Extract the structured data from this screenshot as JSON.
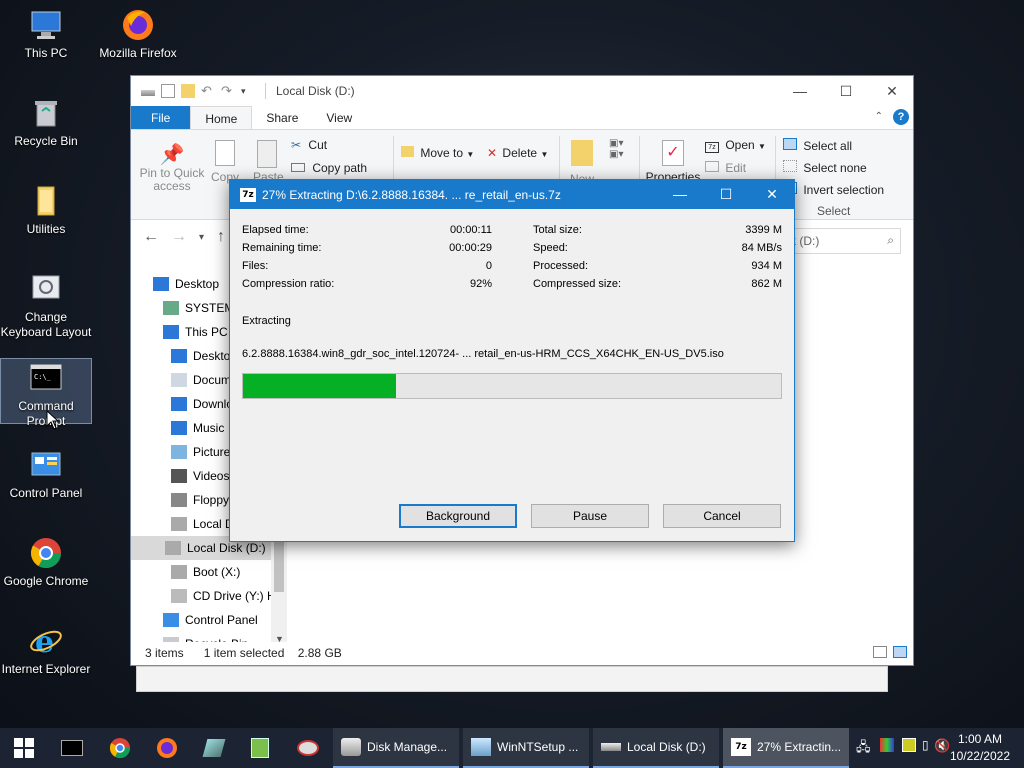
{
  "desktop": {
    "icons": [
      {
        "label": "This PC",
        "icon": "pc-icon"
      },
      {
        "label": "Mozilla Firefox",
        "icon": "firefox-icon"
      },
      {
        "label": "Recycle Bin",
        "icon": "recycle-bin-icon"
      },
      {
        "label": "Utilities",
        "icon": "folder-icon"
      },
      {
        "label": "Change Keyboard Layout",
        "icon": "keyboard-layout-icon"
      },
      {
        "label": "Command Prompt",
        "icon": "cmd-icon"
      },
      {
        "label": "Control Panel",
        "icon": "control-panel-icon"
      },
      {
        "label": "Google Chrome",
        "icon": "chrome-icon"
      },
      {
        "label": "Internet Explorer",
        "icon": "ie-icon"
      }
    ]
  },
  "explorer": {
    "title": "Local Disk (D:)",
    "tabs": {
      "file": "File",
      "home": "Home",
      "share": "Share",
      "view": "View"
    },
    "ribbon": {
      "pin": "Pin to Quick access",
      "copy": "Copy",
      "paste": "Paste",
      "cut": "Cut",
      "copy_path": "Copy path",
      "move_to": "Move to",
      "delete": "Delete",
      "new": "New",
      "properties": "Properties",
      "open": "Open",
      "edit": "Edit",
      "select_all": "Select all",
      "select_none": "Select none",
      "invert_selection": "Invert selection",
      "select_group": "Select"
    },
    "search_placeholder": "k (D:)",
    "tree": [
      {
        "label": "Desktop",
        "icon": "desktop-icon",
        "level": 0
      },
      {
        "label": "SYSTEM",
        "icon": "user-icon",
        "level": 1
      },
      {
        "label": "This PC",
        "icon": "pc-icon",
        "level": 1
      },
      {
        "label": "Desktop",
        "icon": "desktop-icon",
        "level": 2
      },
      {
        "label": "Docum",
        "icon": "documents-icon",
        "level": 2
      },
      {
        "label": "Downlo",
        "icon": "downloads-icon",
        "level": 2
      },
      {
        "label": "Music",
        "icon": "music-icon",
        "level": 2
      },
      {
        "label": "Picture",
        "icon": "pictures-icon",
        "level": 2
      },
      {
        "label": "Videos",
        "icon": "videos-icon",
        "level": 2
      },
      {
        "label": "Floppy",
        "icon": "floppy-icon",
        "level": 2
      },
      {
        "label": "Local D",
        "icon": "drive-icon",
        "level": 2
      },
      {
        "label": "Local Disk (D:)",
        "icon": "drive-icon",
        "level": 2,
        "selected": true
      },
      {
        "label": "Boot (X:)",
        "icon": "drive-icon",
        "level": 2
      },
      {
        "label": "CD Drive (Y:) H",
        "icon": "cd-drive-icon",
        "level": 2
      },
      {
        "label": "Control Panel",
        "icon": "control-panel-icon",
        "level": 1
      },
      {
        "label": "Recycle Bin",
        "icon": "recycle-bin-icon",
        "level": 1
      }
    ],
    "status": {
      "items": "3 items",
      "selected": "1 item selected",
      "size": "2.88 GB"
    }
  },
  "dialog": {
    "title": "27% Extracting D:\\6.2.8888.16384. ... re_retail_en-us.7z",
    "logo": "7z",
    "left": [
      {
        "label": "Elapsed time:",
        "value": "00:00:11"
      },
      {
        "label": "Remaining time:",
        "value": "00:00:29"
      },
      {
        "label": "Files:",
        "value": "0"
      },
      {
        "label": "Compression ratio:",
        "value": "92%"
      }
    ],
    "right": [
      {
        "label": "Total size:",
        "value": "3399 M"
      },
      {
        "label": "Speed:",
        "value": "84 MB/s"
      },
      {
        "label": "Processed:",
        "value": "934 M"
      },
      {
        "label": "Compressed size:",
        "value": "862 M"
      }
    ],
    "action": "Extracting",
    "current_file": "6.2.8888.16384.win8_gdr_soc_intel.120724- ... retail_en-us-HRM_CCS_X64CHK_EN-US_DV5.iso",
    "progress": 0.285,
    "progress_color": "#06b025",
    "buttons": {
      "background": "Background",
      "pause": "Pause",
      "cancel": "Cancel"
    }
  },
  "taskbar": {
    "pinned": [
      "start-icon",
      "cmd-icon",
      "chrome-icon",
      "firefox-icon",
      "tool-icon",
      "registry-icon",
      "paint-icon"
    ],
    "apps": [
      {
        "label": "Disk Manage...",
        "icon": "disk-management-icon"
      },
      {
        "label": "WinNTSetup ...",
        "icon": "winntsetup-icon"
      },
      {
        "label": "Local Disk (D:)",
        "icon": "drive-icon"
      },
      {
        "label": "27% Extractin...",
        "icon": "7zip-icon",
        "active": true
      }
    ],
    "clock": {
      "time": "1:00 AM",
      "date": "10/22/2022"
    }
  },
  "colors": {
    "accent": "#1979ca",
    "progress": "#06b025",
    "taskbar": "#1c2433"
  }
}
